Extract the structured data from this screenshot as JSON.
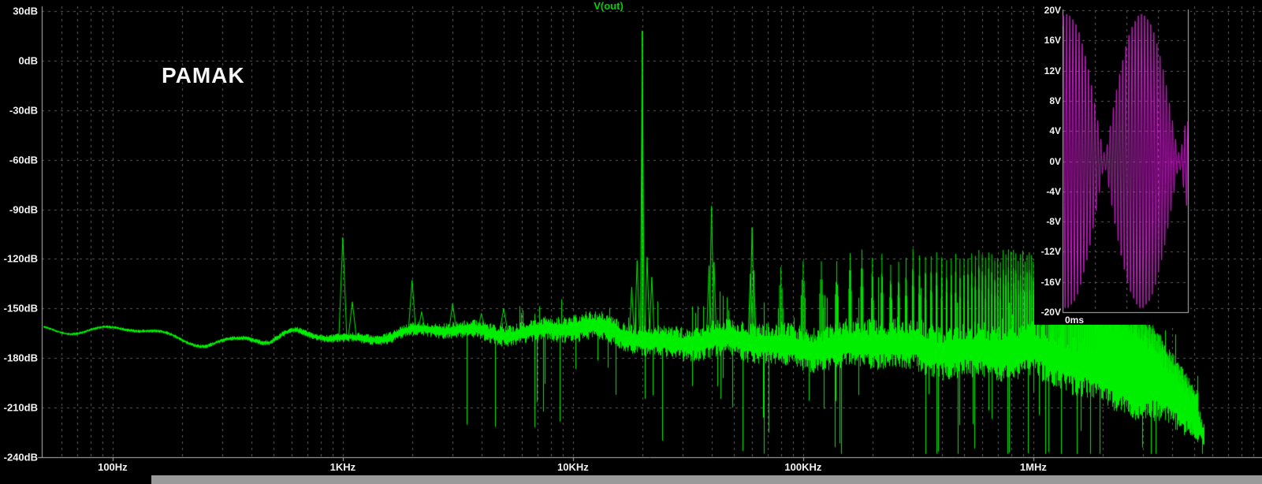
{
  "window": {
    "background": "#000000",
    "bottom_bar_color": "#9a9a9a"
  },
  "watermark": "PAMAK",
  "chart_data": [
    {
      "type": "line",
      "name": "V(out) FFT spectrum",
      "title": "V(out)",
      "trace_color": "#00ef00",
      "grid_color": "#5f5f5f",
      "axis_color": "#b8b8b8",
      "text_color": "#f2f2f2",
      "xscale": "log",
      "xlim_hz": [
        50,
        10000000
      ],
      "ylim_db": [
        -240,
        30
      ],
      "grid": true,
      "x_ticks": [
        {
          "hz": 100,
          "label": "100Hz"
        },
        {
          "hz": 1000,
          "label": "1KHz"
        },
        {
          "hz": 10000,
          "label": "10KHz"
        },
        {
          "hz": 100000,
          "label": "100KHz"
        },
        {
          "hz": 1000000,
          "label": "1MHz"
        }
      ],
      "y_ticks": [
        {
          "db": 30,
          "label": "30dB"
        },
        {
          "db": 0,
          "label": "0dB"
        },
        {
          "db": -30,
          "label": "-30dB"
        },
        {
          "db": -60,
          "label": "-60dB"
        },
        {
          "db": -90,
          "label": "-90dB"
        },
        {
          "db": -120,
          "label": "-120dB"
        },
        {
          "db": -150,
          "label": "-150dB"
        },
        {
          "db": -180,
          "label": "-180dB"
        },
        {
          "db": -210,
          "label": "-210dB"
        },
        {
          "db": -240,
          "label": "-240dB"
        }
      ],
      "peaks_hz_db": [
        [
          1000,
          -107
        ],
        [
          1100,
          -146
        ],
        [
          2000,
          -133
        ],
        [
          2200,
          -152
        ],
        [
          3000,
          -147
        ],
        [
          4000,
          -153
        ],
        [
          5000,
          -150
        ],
        [
          18000,
          -137
        ],
        [
          19000,
          -121
        ],
        [
          20000,
          18
        ],
        [
          21000,
          -119
        ],
        [
          22000,
          -131
        ],
        [
          39000,
          -124
        ],
        [
          40000,
          -88
        ],
        [
          41000,
          -122
        ],
        [
          59000,
          -129
        ],
        [
          60000,
          -101
        ],
        [
          61000,
          -127
        ]
      ],
      "noise_center_db": [
        [
          50,
          -161
        ],
        [
          120,
          -164
        ],
        [
          250,
          -170
        ],
        [
          380,
          -167
        ],
        [
          480,
          -172
        ],
        [
          620,
          -166
        ],
        [
          900,
          -167
        ],
        [
          1500,
          -166
        ],
        [
          3000,
          -164
        ],
        [
          6000,
          -163
        ],
        [
          12000,
          -163
        ],
        [
          25000,
          -169
        ],
        [
          50000,
          -171
        ],
        [
          100000,
          -172
        ],
        [
          250000,
          -173
        ],
        [
          500000,
          -174
        ],
        [
          1000000,
          -178
        ],
        [
          1600000,
          -183
        ],
        [
          2200000,
          -190
        ],
        [
          3000000,
          -198
        ],
        [
          4000000,
          -207
        ],
        [
          5000000,
          -216
        ],
        [
          5500000,
          -228
        ]
      ],
      "noise_spread_db": [
        [
          50,
          0.8
        ],
        [
          300,
          1.2
        ],
        [
          700,
          2
        ],
        [
          1500,
          3.5
        ],
        [
          3000,
          5
        ],
        [
          6000,
          7
        ],
        [
          12000,
          9
        ],
        [
          25000,
          10
        ],
        [
          50000,
          12
        ],
        [
          100000,
          14
        ],
        [
          250000,
          16
        ],
        [
          500000,
          17
        ],
        [
          1000000,
          18
        ],
        [
          2000000,
          20
        ],
        [
          3000000,
          20
        ],
        [
          4000000,
          18
        ],
        [
          5000000,
          14
        ],
        [
          5500000,
          7
        ]
      ],
      "harmonic_comb": {
        "fundamental_hz": 20000,
        "first_n": 4,
        "last_hz": 5200000,
        "sideband_offsets_hz": [
          1000,
          2000
        ],
        "sideband_drop_db_per_khz": 11,
        "top_envelope_hz_db": [
          [
            80000,
            -123
          ],
          [
            100000,
            -118
          ],
          [
            130000,
            -123
          ],
          [
            160000,
            -119
          ],
          [
            200000,
            -117
          ],
          [
            260000,
            -121
          ],
          [
            320000,
            -116
          ],
          [
            400000,
            -120
          ],
          [
            500000,
            -117
          ],
          [
            650000,
            -119
          ],
          [
            800000,
            -117
          ],
          [
            1000000,
            -120
          ],
          [
            1300000,
            -124
          ],
          [
            1600000,
            -129
          ],
          [
            2000000,
            -136
          ],
          [
            2500000,
            -146
          ],
          [
            3200000,
            -160
          ],
          [
            4000000,
            -180
          ],
          [
            5000000,
            -200
          ]
        ]
      },
      "data_end_hz": 5500000
    },
    {
      "type": "line",
      "name": "V(out) time-domain inset",
      "trace_color": "#cf1fcf",
      "grid_color": "#5f5f5f",
      "axis_color": "#b8b8b8",
      "text_color": "#f2f2f2",
      "ylim_v": [
        -20,
        20
      ],
      "y_ticks": [
        {
          "v": 20,
          "label": "20V"
        },
        {
          "v": 16,
          "label": "16V"
        },
        {
          "v": 12,
          "label": "12V"
        },
        {
          "v": 8,
          "label": "8V"
        },
        {
          "v": 4,
          "label": "4V"
        },
        {
          "v": 0,
          "label": "0V"
        },
        {
          "v": -4,
          "label": "-4V"
        },
        {
          "v": -8,
          "label": "-8V"
        },
        {
          "v": -12,
          "label": "-12V"
        },
        {
          "v": -16,
          "label": "-16V"
        },
        {
          "v": -20,
          "label": "-20V"
        }
      ],
      "x_first_tick_label": "0ms",
      "waveform": {
        "kind": "amplitude_modulated_sine",
        "amplitude_v": 19.5,
        "carrier_cycles_visible": 40,
        "envelope": "rectified_sine",
        "envelope_null_u": 0.33,
        "envelope_half_period_u": 0.6,
        "envelope_min_fraction": 0.06,
        "carrier_phase_rad": 1.2
      }
    }
  ]
}
